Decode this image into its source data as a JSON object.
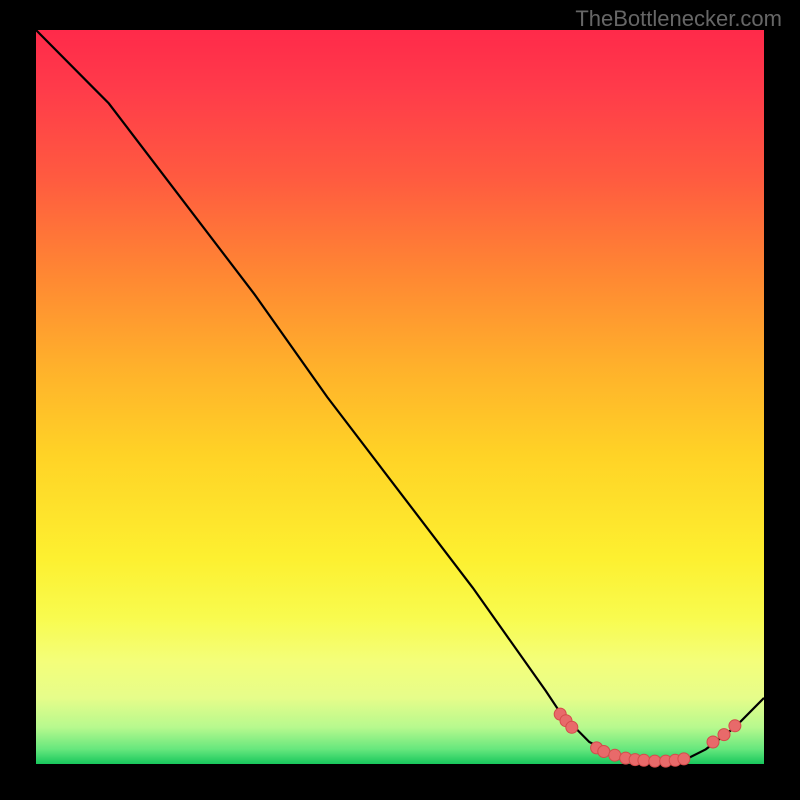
{
  "watermark": "TheBottlenecker.com",
  "chart_data": {
    "type": "line",
    "title": "",
    "xlabel": "",
    "ylabel": "",
    "xlim": [
      0,
      100
    ],
    "ylim": [
      0,
      100
    ],
    "series": [
      {
        "name": "curve",
        "x": [
          0,
          8,
          10,
          20,
          30,
          40,
          50,
          60,
          70,
          72,
          76,
          80,
          84,
          88,
          92,
          96,
          100
        ],
        "y": [
          100,
          92,
          90,
          77,
          64,
          50,
          37,
          24,
          10,
          7,
          3,
          1,
          0,
          0,
          2,
          5,
          9
        ]
      }
    ],
    "markers": {
      "name": "highlighted-points",
      "x": [
        72.0,
        72.8,
        73.6,
        77.0,
        78.0,
        79.5,
        81.0,
        82.3,
        83.5,
        85.0,
        86.5,
        87.8,
        89.0,
        93.0,
        94.5,
        96.0
      ],
      "y": [
        6.8,
        5.9,
        5.0,
        2.2,
        1.7,
        1.2,
        0.8,
        0.6,
        0.5,
        0.4,
        0.4,
        0.5,
        0.7,
        3.0,
        4.0,
        5.2
      ]
    },
    "colors": {
      "curve": "#000000",
      "marker_fill": "#e86a6a",
      "marker_stroke": "#d44b4b"
    }
  }
}
